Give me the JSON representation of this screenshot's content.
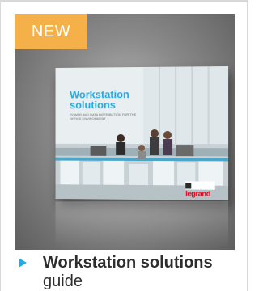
{
  "badge": {
    "label": "NEW"
  },
  "brochure": {
    "title": "Workstation solutions",
    "subtitle": "Power and data distribution for the office environment",
    "brand": "legrand"
  },
  "caption": {
    "title": "Workstation solutions",
    "subtitle": "guide"
  },
  "colors": {
    "badge": "#f6b04a",
    "accent": "#27a9e1",
    "brand_red": "#e2001a",
    "text": "#2d2d2d"
  },
  "icons": {
    "caption_arrow": "play-triangle-icon"
  }
}
